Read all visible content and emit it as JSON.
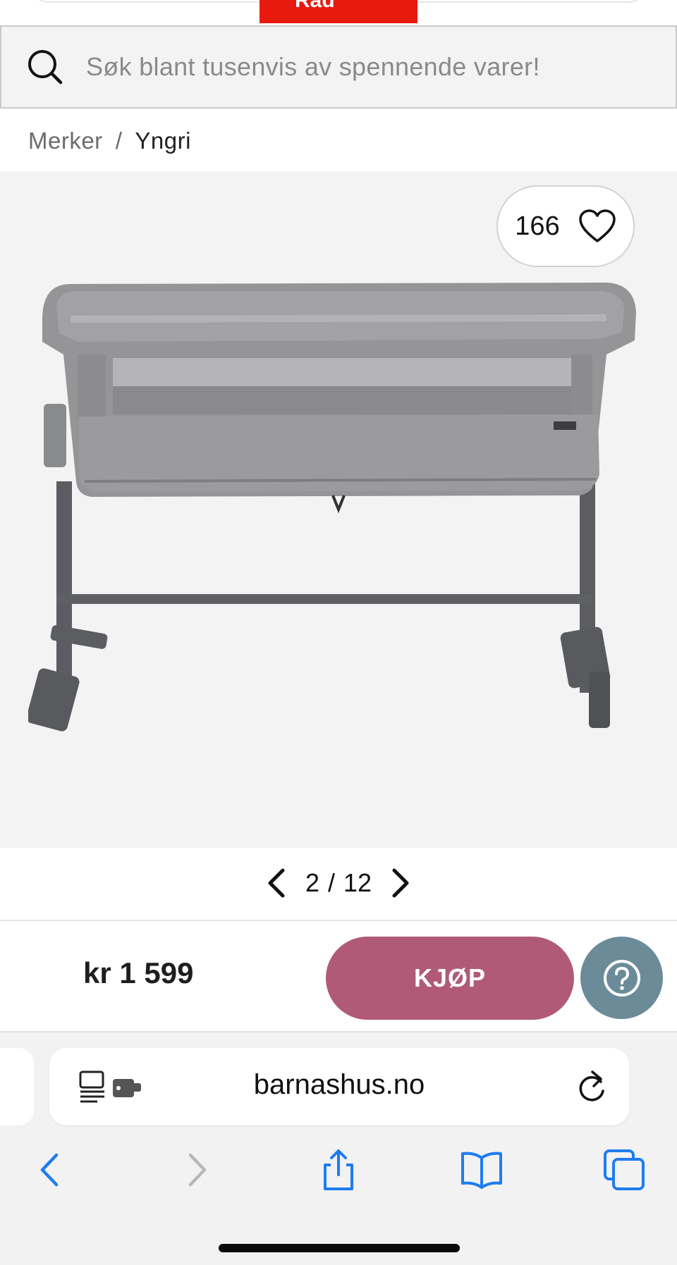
{
  "header": {
    "banner_label": "Råd"
  },
  "search": {
    "placeholder": "Søk blant tusenvis av spennende varer!"
  },
  "breadcrumb": {
    "items": [
      "Merker",
      "Yngri"
    ],
    "separator": "/"
  },
  "gallery": {
    "favorite_count": "166",
    "current": "2",
    "separator": "/",
    "total": "12",
    "image_icon": "bassinet-product-image"
  },
  "buy": {
    "price": "kr 1 599",
    "buy_label": "KJØP",
    "help_icon": "question-circle-icon"
  },
  "browser": {
    "url": "barnashus.no",
    "toolbar": [
      "back-icon",
      "forward-icon",
      "share-icon",
      "bookmarks-icon",
      "tabs-icon"
    ]
  },
  "colors": {
    "brand_red": "#e8190f",
    "buy_button": "#b05a78",
    "help_button": "#6b8b99",
    "safari_blue": "#1e7cf0"
  }
}
